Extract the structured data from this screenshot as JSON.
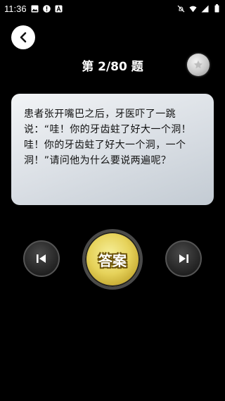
{
  "status_bar": {
    "time": "11:36",
    "left_icons": [
      "image-icon",
      "alert-icon",
      "a-icon"
    ],
    "right_icons": [
      "mute-icon",
      "wifi-icon",
      "signal-icon",
      "battery-icon"
    ]
  },
  "header": {
    "title": "第 2/80 题",
    "back_icon": "chevron-left-icon",
    "favorite_icon": "star-icon"
  },
  "question": {
    "text": "患者张开嘴巴之后，牙医吓了一跳说：“哇！你的牙齿蛀了好大一个洞！哇！你的牙齿蛀了好大一个洞，一个洞！”请问他为什么要说两遍呢？"
  },
  "controls": {
    "prev_icon": "skip-previous-icon",
    "answer_label": "答案",
    "next_icon": "skip-next-icon"
  },
  "colors": {
    "background": "#000000",
    "card": "#dfe3e8",
    "answer_gold": "#e6d25a"
  }
}
